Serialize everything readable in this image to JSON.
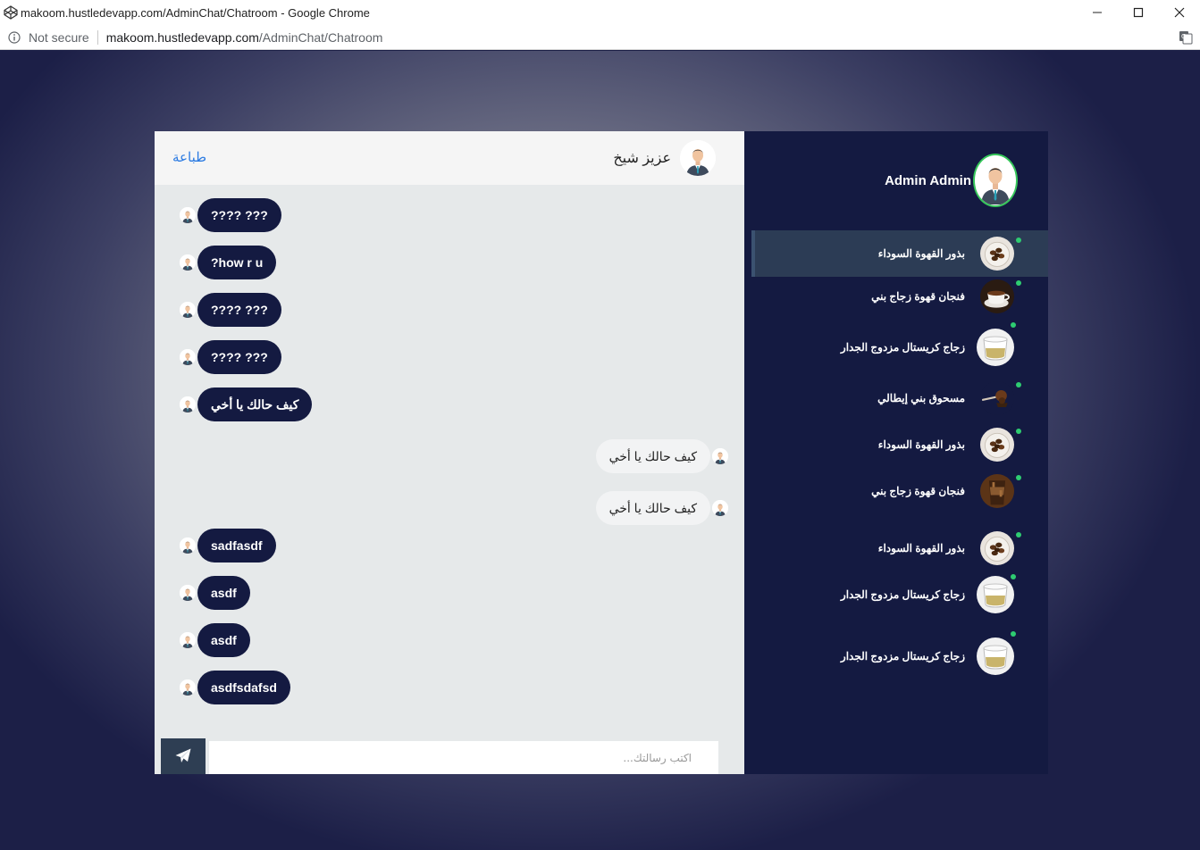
{
  "browser": {
    "window_title": "makoom.hustledevapp.com/AdminChat/Chatroom - Google Chrome",
    "security_label": "Not secure",
    "url_host": "makoom.hustledevapp.com",
    "url_path": "/AdminChat/Chatroom"
  },
  "chat": {
    "print_label": "طباعة",
    "contact_name": "عزيز شيخ",
    "messages": [
      {
        "direction": "in",
        "text": "???? ???"
      },
      {
        "direction": "in",
        "text": "?how r u"
      },
      {
        "direction": "in",
        "text": "???? ???"
      },
      {
        "direction": "in",
        "text": "???? ???"
      },
      {
        "direction": "in",
        "text": "كيف حالك يا أخي"
      },
      {
        "direction": "out",
        "text": "كيف حالك يا أخي"
      },
      {
        "direction": "out",
        "text": "كيف حالك يا أخي"
      },
      {
        "direction": "in",
        "text": "sadfasdf"
      },
      {
        "direction": "in",
        "text": "asdf"
      },
      {
        "direction": "in",
        "text": "asdf"
      },
      {
        "direction": "in",
        "text": "asdfsdafsd"
      }
    ],
    "input_placeholder": "اكتب رسالتك..."
  },
  "sidebar": {
    "admin_name": "Admin Admin",
    "online_color": "#2ecc71",
    "items": [
      {
        "label": "بذور القهوة السوداء",
        "thumb": "coffee-beans",
        "active": true
      },
      {
        "label": "فنجان قهوة زجاج بني",
        "thumb": "coffee-cup",
        "active": false
      },
      {
        "label": "زجاج كريستال مزدوج الجدار",
        "thumb": "glass-cup",
        "active": false
      },
      {
        "label": "مسحوق بني إيطالي",
        "thumb": "coffee-powder",
        "active": false
      },
      {
        "label": "بذور القهوة السوداء",
        "thumb": "coffee-beans",
        "active": false
      },
      {
        "label": "فنجان قهوة زجاج بني",
        "thumb": "iced-coffee",
        "active": false
      },
      {
        "label": "بذور القهوة السوداء",
        "thumb": "coffee-beans",
        "active": false
      },
      {
        "label": "زجاج كريستال مزدوج الجدار",
        "thumb": "glass-cup",
        "active": false
      },
      {
        "label": "زجاج كريستال مزدوج الجدار",
        "thumb": "glass-cup",
        "active": false
      }
    ]
  }
}
